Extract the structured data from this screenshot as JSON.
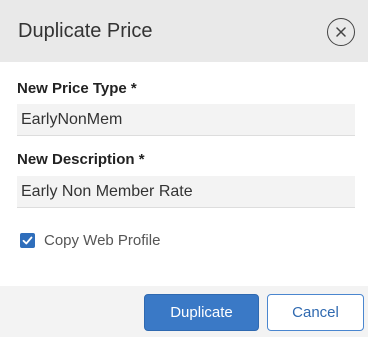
{
  "dialog": {
    "title": "Duplicate Price",
    "close_icon": "close-circle-icon"
  },
  "form": {
    "price_type": {
      "label": "New Price Type *",
      "value": "EarlyNonMem"
    },
    "description": {
      "label": "New Description *",
      "value": "Early Non Member Rate"
    },
    "copy_web_profile": {
      "label": "Copy Web Profile",
      "checked": true,
      "icon": "checkmark-icon"
    }
  },
  "footer": {
    "primary_label": "Duplicate",
    "secondary_label": "Cancel"
  },
  "colors": {
    "header_bg": "#e9e9e9",
    "primary": "#3a79c6",
    "checkbox": "#2f6ebb"
  }
}
